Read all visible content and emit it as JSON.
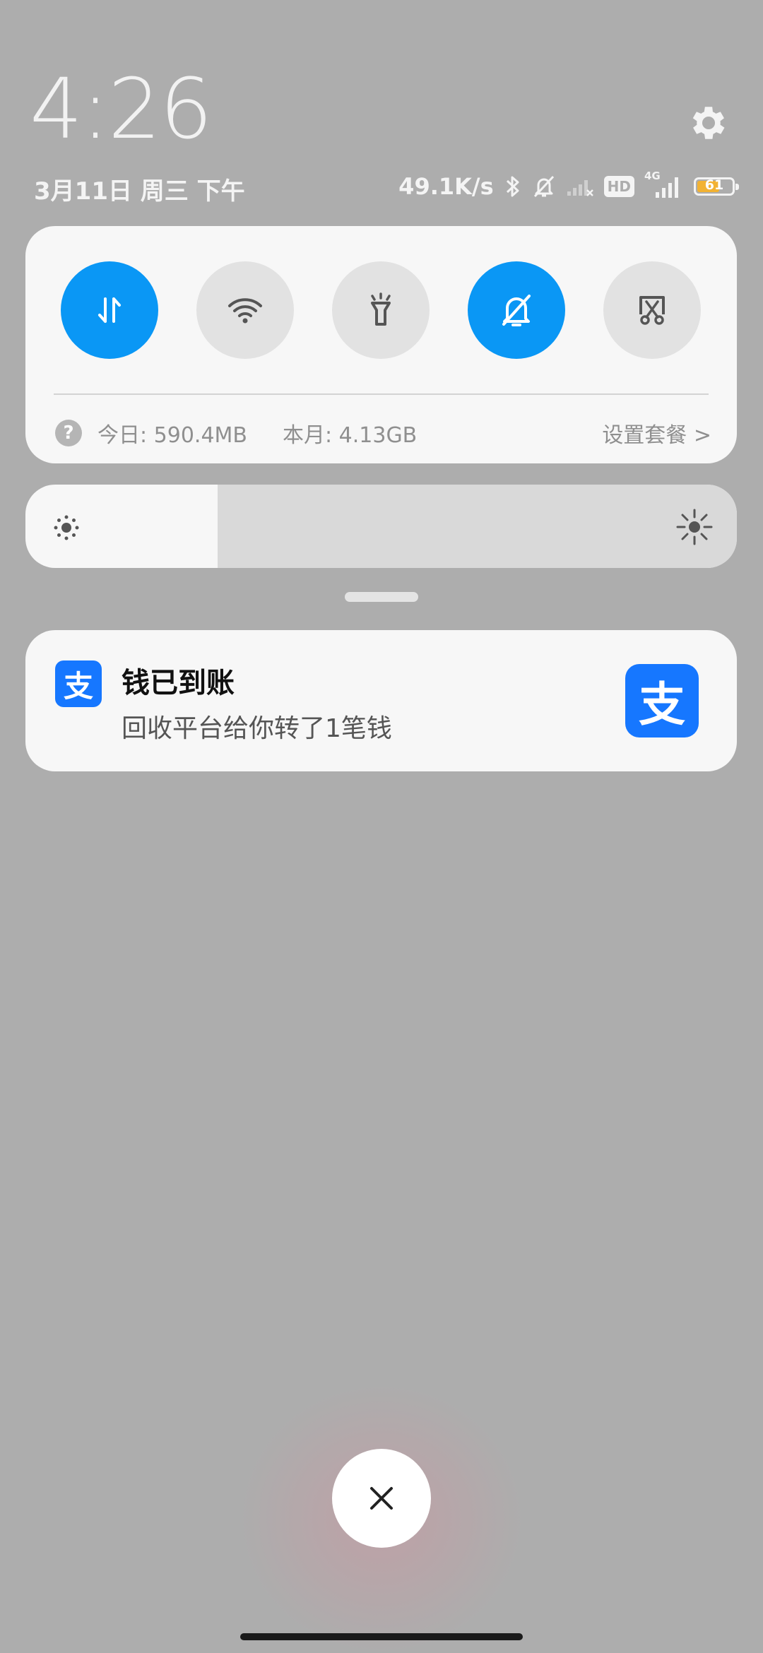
{
  "status_header": {
    "time": "4:26",
    "date": "3月11日 周三 下午",
    "network_speed": "49.1K/s",
    "network_type": "4G",
    "hd_label": "HD",
    "battery_level": "61",
    "settings_icon": "gear-icon"
  },
  "quick_toggles": [
    {
      "icon": "mobile-data-icon",
      "on": true
    },
    {
      "icon": "wifi-icon",
      "on": false
    },
    {
      "icon": "flashlight-icon",
      "on": false
    },
    {
      "icon": "silent-mode-icon",
      "on": true
    },
    {
      "icon": "screenshot-icon",
      "on": false
    }
  ],
  "data_usage": {
    "help_icon_label": "?",
    "today": "今日: 590.4MB",
    "month": "本月: 4.13GB",
    "plan_link": "设置套餐 >"
  },
  "brightness": {
    "level": 0.27,
    "low_icon": "brightness-low-icon",
    "high_icon": "brightness-high-icon"
  },
  "notification": {
    "app_icon_label": "支",
    "title": "钱已到账",
    "body": "回收平台给你转了1笔钱",
    "large_icon_label": "支"
  },
  "colors": {
    "accent": "#0a97f5",
    "alipay_blue": "#1677ff",
    "battery": "#f2b233",
    "background": "#adadad"
  }
}
